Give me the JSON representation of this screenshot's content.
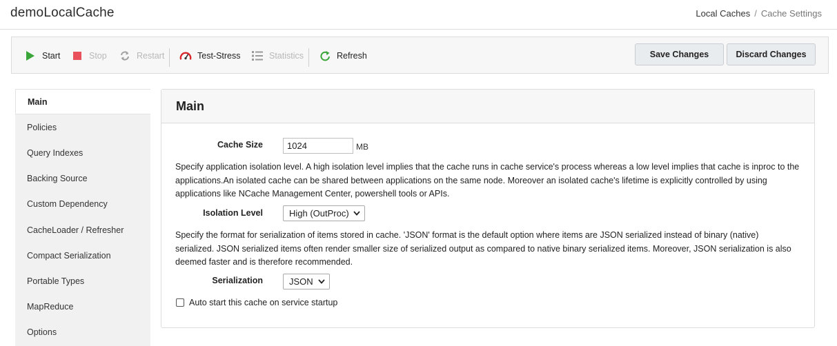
{
  "app": {
    "title": "demoLocalCache"
  },
  "breadcrumb": {
    "parent": "Local Caches",
    "separator": "/",
    "current": "Cache Settings"
  },
  "toolbar": {
    "start": "Start",
    "stop": "Stop",
    "restart": "Restart",
    "test_stress": "Test-Stress",
    "statistics": "Statistics",
    "refresh": "Refresh",
    "save": "Save Changes",
    "discard": "Discard Changes",
    "icons": {
      "start": "play-icon",
      "stop": "stop-icon",
      "restart": "restart-icon",
      "test_stress": "gauge-icon",
      "statistics": "list-icon",
      "refresh": "refresh-icon"
    },
    "colors": {
      "start": "#3aa63a",
      "stop": "#e8505b",
      "gauge": "#d9262d",
      "refresh": "#3aa63a"
    }
  },
  "sidebar": {
    "items": [
      {
        "label": "Main",
        "active": true
      },
      {
        "label": "Policies"
      },
      {
        "label": "Query Indexes"
      },
      {
        "label": "Backing Source"
      },
      {
        "label": "Custom Dependency"
      },
      {
        "label": "CacheLoader / Refresher"
      },
      {
        "label": "Compact Serialization"
      },
      {
        "label": "Portable Types"
      },
      {
        "label": "MapReduce"
      },
      {
        "label": "Options"
      }
    ]
  },
  "main": {
    "title": "Main",
    "cache_size": {
      "label": "Cache Size",
      "value": "1024",
      "unit": "MB"
    },
    "isolation_desc": "Specify application isolation level. A high isolation level implies that the cache runs in cache service's process whereas a low level implies that cache is inproc to the applications.An isolated cache can be shared between applications on the same node. Moreover an isolated cache's lifetime is explicitly controlled by using applications like NCache Management Center, powershell tools or APIs.",
    "isolation": {
      "label": "Isolation Level",
      "value": "High (OutProc)"
    },
    "serialization_desc": "Specify the format for serialization of items stored in cache. 'JSON' format is the default option where items are JSON serialized instead of binary (native) serialized. JSON serialized items often render smaller size of serialized output as compared to native binary serialized items. Moreover, JSON serialization is also deemed faster and is therefore recommended.",
    "serialization": {
      "label": "Serialization",
      "value": "JSON"
    },
    "auto_start": {
      "label": "Auto start this cache on service startup",
      "checked": false
    }
  }
}
